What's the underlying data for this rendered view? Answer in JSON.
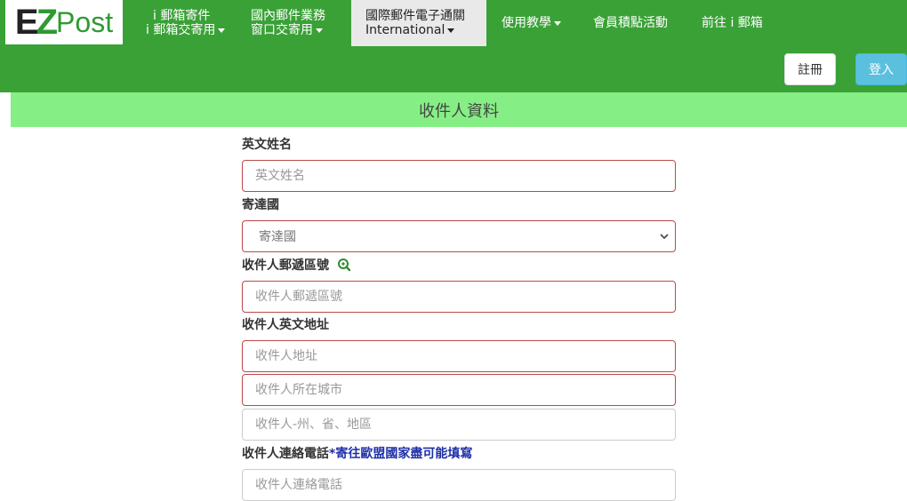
{
  "brand": {
    "logo_e": "E",
    "logo_z": "Z",
    "logo_post": "Post"
  },
  "nav": {
    "items": [
      {
        "line1": "i 郵箱寄件",
        "line2": "i 郵箱交寄用"
      },
      {
        "line1": "國內郵件業務",
        "line2": "窗口交寄用"
      },
      {
        "line1": "國際郵件電子通關",
        "line2": "International"
      },
      {
        "label": "使用教學"
      },
      {
        "label": "會員積點活動"
      },
      {
        "label": "前往 i 郵箱"
      }
    ],
    "register": "註冊",
    "login": "登入"
  },
  "section": {
    "title": "收件人資料"
  },
  "form": {
    "english_name": {
      "label": "英文姓名",
      "placeholder": "英文姓名"
    },
    "country": {
      "label": "寄達國",
      "selected": "寄達國"
    },
    "postal_code": {
      "label": "收件人郵遞區號",
      "placeholder": "收件人郵遞區號"
    },
    "address": {
      "label": "收件人英文地址",
      "address_placeholder": "收件人地址",
      "city_placeholder": "收件人所在城市",
      "state_placeholder": "收件人-州、省、地區"
    },
    "phone": {
      "label": "收件人連絡電話",
      "hint": "*寄往歐盟國家盡可能填寫",
      "placeholder": "收件人連絡電話"
    }
  },
  "colors": {
    "navbar": "#3aa137",
    "section_header": "#85ef85",
    "invalid_border": "#b94a48",
    "login_button": "#5bc0de",
    "hint_text": "#1f2fa8"
  },
  "icons": {
    "postal_lookup": "search-icon"
  }
}
